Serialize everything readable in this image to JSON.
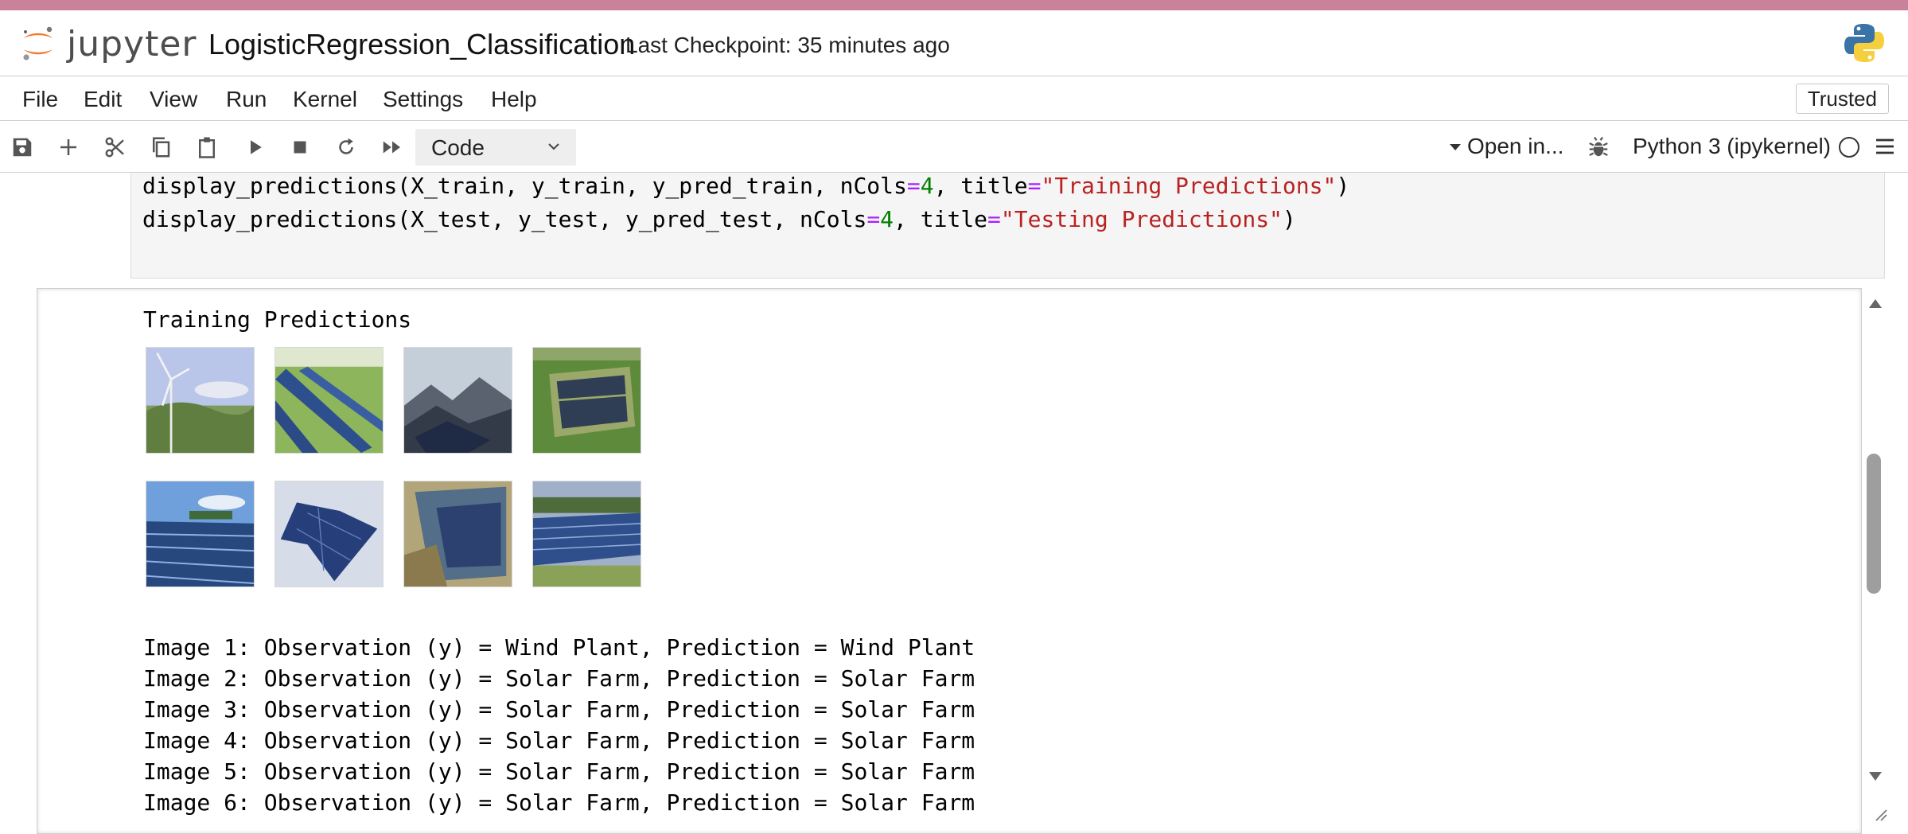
{
  "app": {
    "logo_text": "jupyter",
    "notebook_title": "LogisticRegression_Classification",
    "checkpoint": "Last Checkpoint: 35 minutes ago",
    "accent_color": "#c9829a"
  },
  "menu": {
    "items": [
      "File",
      "Edit",
      "View",
      "Run",
      "Kernel",
      "Settings",
      "Help"
    ],
    "trusted": "Trusted"
  },
  "toolbar": {
    "icons": [
      "save-icon",
      "add-cell-icon",
      "cut-icon",
      "copy-icon",
      "paste-icon",
      "run-icon",
      "stop-icon",
      "restart-icon",
      "fast-forward-icon"
    ],
    "cell_type": "Code",
    "open_in": "Open in...",
    "kernel": "Python 3 (ipykernel)"
  },
  "code_cell": {
    "lines": [
      [
        {
          "t": "display_predictions(X_train, y_train, y_pred_train, nCols",
          "c": ""
        },
        {
          "t": "=",
          "c": "op"
        },
        {
          "t": "4",
          "c": "num"
        },
        {
          "t": ", title",
          "c": ""
        },
        {
          "t": "=",
          "c": "op"
        },
        {
          "t": "\"Training Predictions\"",
          "c": "str"
        },
        {
          "t": ")",
          "c": ""
        }
      ],
      [
        {
          "t": "display_predictions(X_test, y_test, y_pred_test, nCols",
          "c": ""
        },
        {
          "t": "=",
          "c": "op"
        },
        {
          "t": "4",
          "c": "num"
        },
        {
          "t": ", title",
          "c": ""
        },
        {
          "t": "=",
          "c": "op"
        },
        {
          "t": "\"Testing Predictions\"",
          "c": "str"
        },
        {
          "t": ")",
          "c": ""
        }
      ]
    ]
  },
  "output": {
    "heading": "Training Predictions",
    "thumbnails": [
      {
        "name": "wind-turbine-image",
        "kind": "wind"
      },
      {
        "name": "solar-field-image",
        "kind": "solar-green"
      },
      {
        "name": "mountain-solar-image",
        "kind": "mountain"
      },
      {
        "name": "aerial-solar-image",
        "kind": "aerial"
      },
      {
        "name": "solar-panels-sky-image",
        "kind": "panels-sky"
      },
      {
        "name": "floating-solar-image",
        "kind": "floating"
      },
      {
        "name": "solar-lake-image",
        "kind": "lake"
      },
      {
        "name": "solar-rows-image",
        "kind": "rows"
      }
    ],
    "lines": [
      "Image 1: Observation (y) = Wind Plant, Prediction = Wind Plant",
      "Image 2: Observation (y) = Solar Farm, Prediction = Solar Farm",
      "Image 3: Observation (y) = Solar Farm, Prediction = Solar Farm",
      "Image 4: Observation (y) = Solar Farm, Prediction = Solar Farm",
      "Image 5: Observation (y) = Solar Farm, Prediction = Solar Farm",
      "Image 6: Observation (y) = Solar Farm, Prediction = Solar Farm"
    ]
  }
}
